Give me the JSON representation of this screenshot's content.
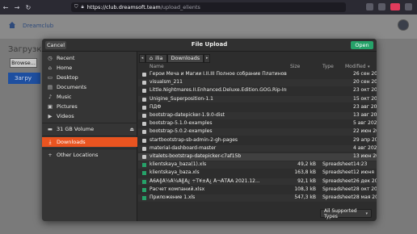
{
  "browser": {
    "url_host": "https://club.dreamsoft.team",
    "url_path": "/upload_elients"
  },
  "page": {
    "brand": "Dreamclub",
    "title": "Загрузка",
    "browse_label": "Browse...",
    "upload_label": "Загру"
  },
  "dialog": {
    "title": "File Upload",
    "cancel_label": "Cancel",
    "open_label": "Open",
    "path": {
      "user": "ilia",
      "current": "Downloads"
    },
    "columns": {
      "name": "Name",
      "size": "Size",
      "type": "Type",
      "modified": "Modified"
    },
    "filter_label": "All Supported Types"
  },
  "sidebar": {
    "items": [
      {
        "label": "Recent",
        "icon": "clock-icon"
      },
      {
        "label": "Home",
        "icon": "home-icon"
      },
      {
        "label": "Desktop",
        "icon": "desktop-icon"
      },
      {
        "label": "Documents",
        "icon": "documents-icon"
      },
      {
        "label": "Music",
        "icon": "music-icon"
      },
      {
        "label": "Pictures",
        "icon": "pictures-icon"
      },
      {
        "label": "Videos",
        "icon": "videos-icon"
      },
      {
        "label": "31 GB Volume",
        "icon": "drive-icon"
      },
      {
        "label": "Downloads",
        "icon": "downloads-icon"
      },
      {
        "label": "Other Locations",
        "icon": "plus-icon"
      }
    ]
  },
  "files": [
    {
      "name": "Герои Меча и Магии I.II.III Полное собрание Платиновая сер...",
      "size": "",
      "type": "",
      "modified": "26 сен 2021",
      "kind": "folder"
    },
    {
      "name": "visualsm_211",
      "size": "",
      "type": "",
      "modified": "20 сен 2021",
      "kind": "folder"
    },
    {
      "name": "Little.Nightmares.II.Enhanced.Deluxe.Edition.GOG.Rip-Insane...",
      "size": "",
      "type": "",
      "modified": "23 окт 2021",
      "kind": "folder"
    },
    {
      "name": "Unigine_Superposition-1.1",
      "size": "",
      "type": "",
      "modified": "15 окт 2021",
      "kind": "folder"
    },
    {
      "name": "ПДФ",
      "size": "",
      "type": "",
      "modified": "23 авг 2021",
      "kind": "folder"
    },
    {
      "name": "bootstrap-datepicker-1.9.0-dist",
      "size": "",
      "type": "",
      "modified": "13 авг 2021",
      "kind": "folder"
    },
    {
      "name": "bootstrap-5.1.0-examples",
      "size": "",
      "type": "",
      "modified": "5 авг 2021",
      "kind": "folder"
    },
    {
      "name": "bootstrap-5.0.2-examples",
      "size": "",
      "type": "",
      "modified": "22 июн 2021",
      "kind": "folder"
    },
    {
      "name": "startbootstrap-sb-admin-2-gh-pages",
      "size": "",
      "type": "",
      "modified": "29 апр 2021",
      "kind": "folder"
    },
    {
      "name": "material-dashboard-master",
      "size": "",
      "type": "",
      "modified": "4 авг 2020",
      "kind": "folder"
    },
    {
      "name": "vitalets-bootstrap-datepicker-c7af15b",
      "size": "",
      "type": "",
      "modified": "13 июн 2013",
      "kind": "folder",
      "selected": true
    },
    {
      "name": "klientskaya_baza(1).xls",
      "size": "49,2 kB",
      "type": "Spreadsheet",
      "modified": "14:23",
      "kind": "sheet"
    },
    {
      "name": "klientskaya_baza.xls",
      "size": "163,8 kB",
      "type": "Spreadsheet",
      "modified": "12 июня",
      "kind": "sheet"
    },
    {
      "name": "Å6Â╢Å½Å¼Å╢Å¿ ÷Ť¥±Å¿ Å¬ÅŤÅÁ 2021.12...",
      "size": "92,1 kB",
      "type": "Spreadsheet",
      "modified": "26 дек 2021",
      "kind": "sheet"
    },
    {
      "name": "Расчет компаний.xlsx",
      "size": "108,3 kB",
      "type": "Spreadsheet",
      "modified": "28 окт 2021",
      "kind": "sheet"
    },
    {
      "name": "Приложение 1.xls",
      "size": "547,3 kB",
      "type": "Spreadsheet",
      "modified": "28 мая 2019",
      "kind": "sheet"
    }
  ]
}
